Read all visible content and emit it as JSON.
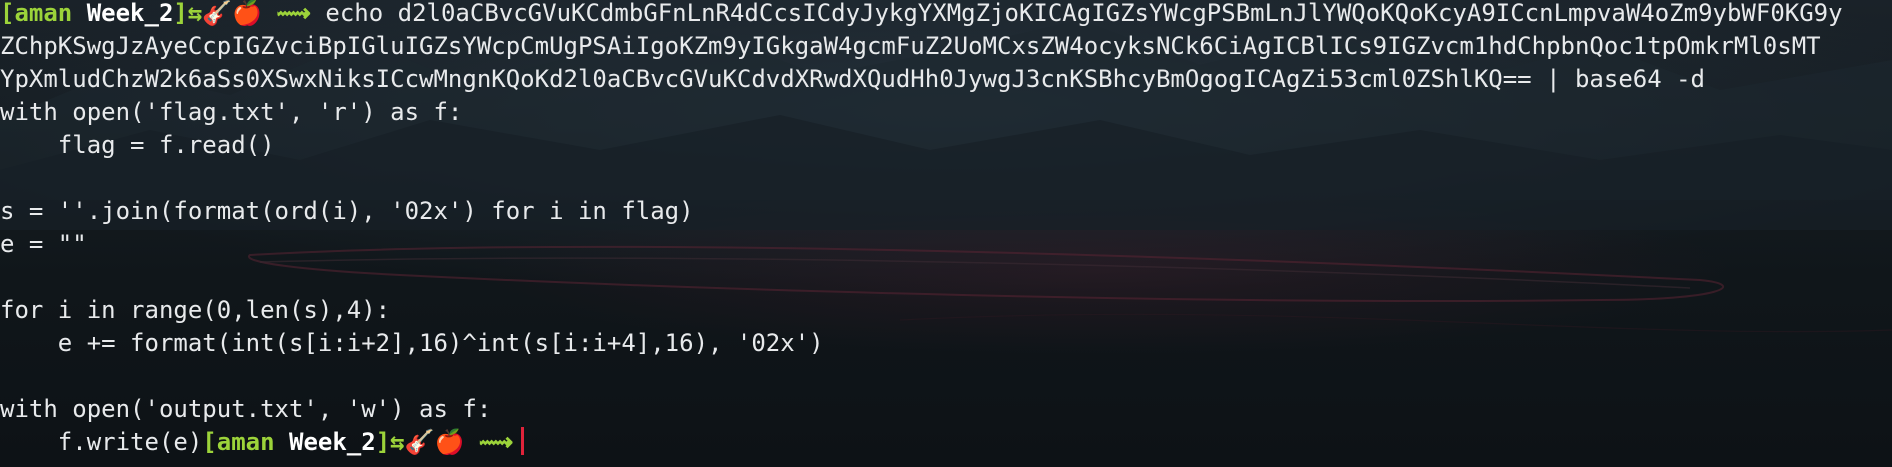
{
  "prompt": {
    "user": "aman",
    "dir": "Week_2",
    "icons": "⇆🎸🍎",
    "arrow": "⟿"
  },
  "command": {
    "line1": "echo d2l0aCBvcGVuKCdmbGFnLnR4dCcsICdyJykgYXMgZjoKICAgIGZsYWcgPSBmLnJlYWQoKQoKcyA9ICcnLmpvaW4oZm9ybWF0KG9y",
    "line2": "ZChpKSwgJzAyeCcpIGZvciBpIGluIGZsYWcpCmUgPSAiIgoKZm9yIGkgaW4gcmFuZ2UoMCxsZW4ocyksNCk6CiAgICBlICs9IGZvcm1hdChpbnQoc1tpOmkrMl0sMT",
    "line3": "YpXmludChzW2k6aSs0XSwxNiksICcwMngnKQoKd2l0aCBvcGVuKCdvdXRwdXQudHh0JywgJ3cnKSBhcyBmOgogICAgZi53cml0ZShlKQ== | base64 -d"
  },
  "output": {
    "l1": "with open('flag.txt', 'r') as f:",
    "l2": "    flag = f.read()",
    "l3": "s = ''.join(format(ord(i), '02x') for i in flag)",
    "l4": "e = \"\"",
    "l5": "for i in range(0,len(s),4):",
    "l6": "    e += format(int(s[i:i+2],16)^int(s[i:i+4],16), '02x')",
    "l7": "with open('output.txt', 'w') as f:",
    "l8": "    f.write(e)"
  },
  "colors": {
    "prompt_green": "#9cd33a",
    "cursor_red": "#e0233a",
    "text": "#e8eaec"
  }
}
